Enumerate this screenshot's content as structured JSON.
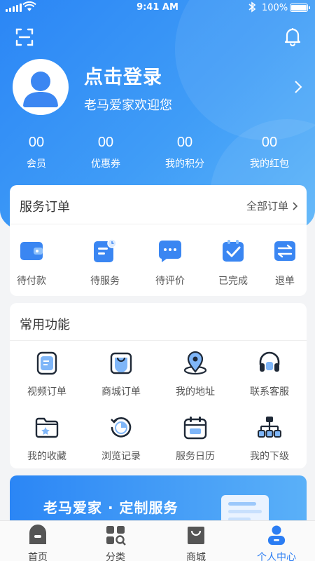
{
  "status_bar": {
    "time": "9:41 AM",
    "battery": "100%"
  },
  "profile": {
    "login_title": "点击登录",
    "welcome": "老马爱家欢迎您"
  },
  "stats": [
    {
      "value": "00",
      "label": "会员"
    },
    {
      "value": "00",
      "label": "优惠券"
    },
    {
      "value": "00",
      "label": "我的积分"
    },
    {
      "value": "00",
      "label": "我的红包"
    }
  ],
  "orders": {
    "title": "服务订单",
    "all_link": "全部订单",
    "items": [
      {
        "label": "待付款",
        "icon": "wallet-icon"
      },
      {
        "label": "待服务",
        "icon": "clock-doc-icon"
      },
      {
        "label": "待评价",
        "icon": "chat-icon"
      },
      {
        "label": "已完成",
        "icon": "check-icon"
      },
      {
        "label": "退单",
        "icon": "refund-icon"
      }
    ]
  },
  "functions": {
    "title": "常用功能",
    "items": [
      {
        "label": "视频订单",
        "icon": "video-order-icon"
      },
      {
        "label": "商城订单",
        "icon": "mall-order-icon"
      },
      {
        "label": "我的地址",
        "icon": "location-icon"
      },
      {
        "label": "联系客服",
        "icon": "headset-icon"
      },
      {
        "label": "我的收藏",
        "icon": "favorite-folder-icon"
      },
      {
        "label": "浏览记录",
        "icon": "history-icon"
      },
      {
        "label": "服务日历",
        "icon": "calendar-icon"
      },
      {
        "label": "我的下级",
        "icon": "org-chart-icon"
      }
    ]
  },
  "banner": {
    "text": "老马爱家 · 定制服务"
  },
  "tabbar": [
    {
      "label": "首页",
      "icon": "home-icon"
    },
    {
      "label": "分类",
      "icon": "category-icon"
    },
    {
      "label": "商城",
      "icon": "shop-bag-icon"
    },
    {
      "label": "个人中心",
      "icon": "user-icon"
    }
  ],
  "colors": {
    "primary": "#2b86f5",
    "accent_light": "#5ab4f9",
    "icon_dark": "#1f2937",
    "tab_active": "#2b7df3"
  }
}
